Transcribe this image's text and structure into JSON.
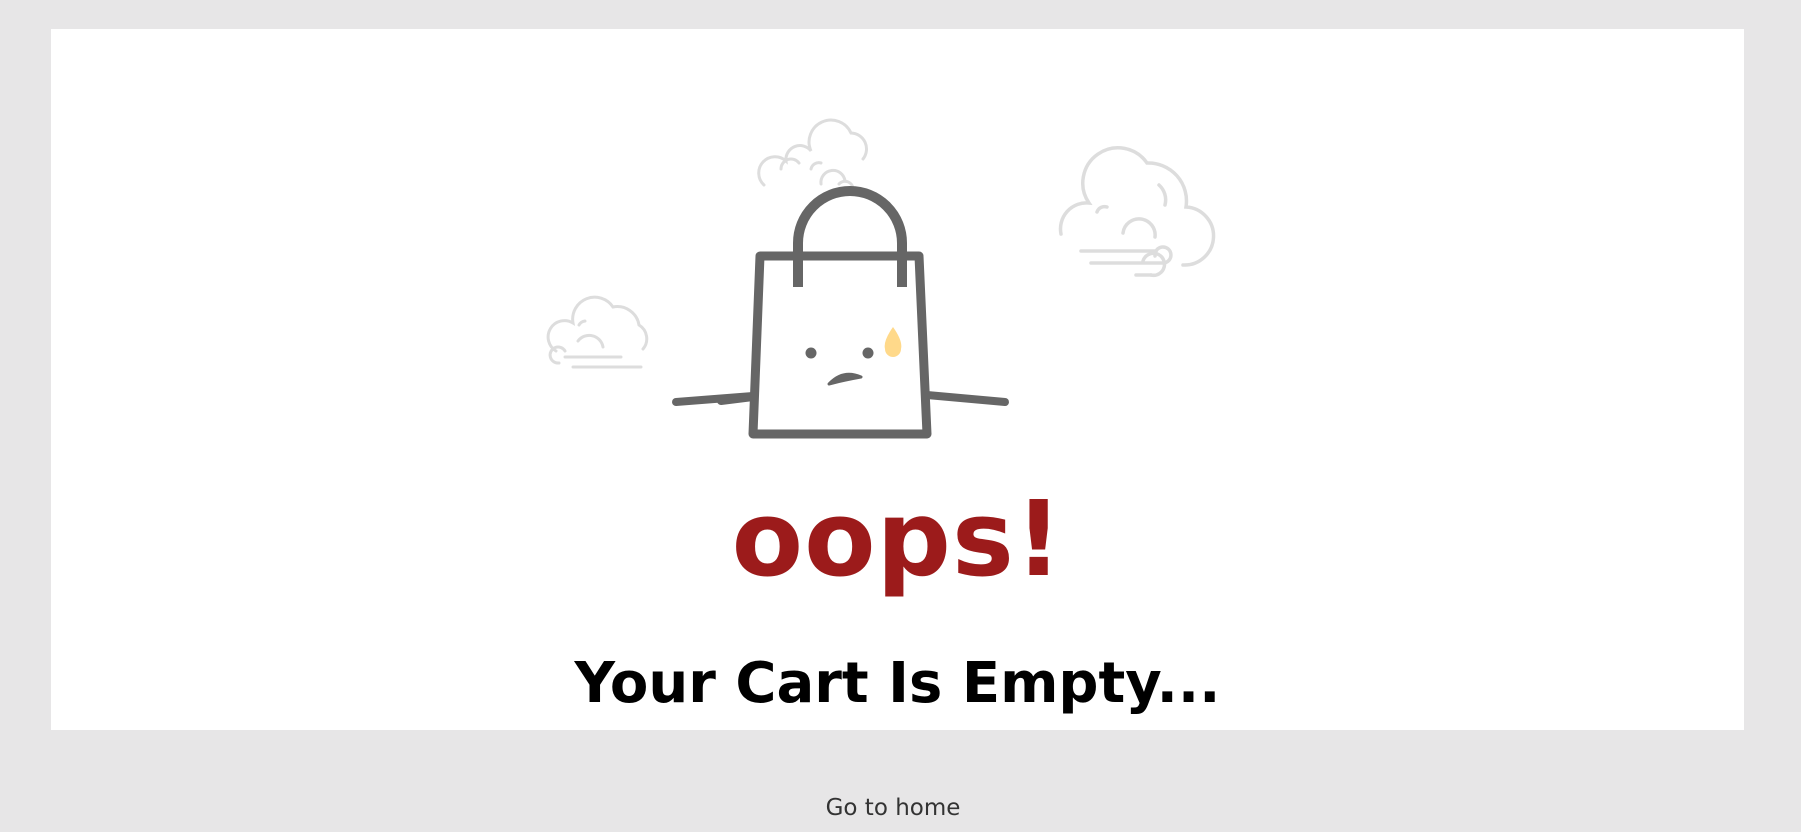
{
  "empty_cart": {
    "exclamation": "oops!",
    "message": "Your Cart Is Empty...",
    "illustration_icon": "sad-shopping-bag-icon",
    "cloud_icon": "cloud-icon"
  },
  "navigation": {
    "home_link_label": "Go to home"
  },
  "colors": {
    "page_background": "#e7e6e7",
    "card_background": "#ffffff",
    "accent_red": "#9c1b1b",
    "bag_stroke": "#666666",
    "cloud_stroke": "#dddddd",
    "tear": "#ffd98a"
  }
}
